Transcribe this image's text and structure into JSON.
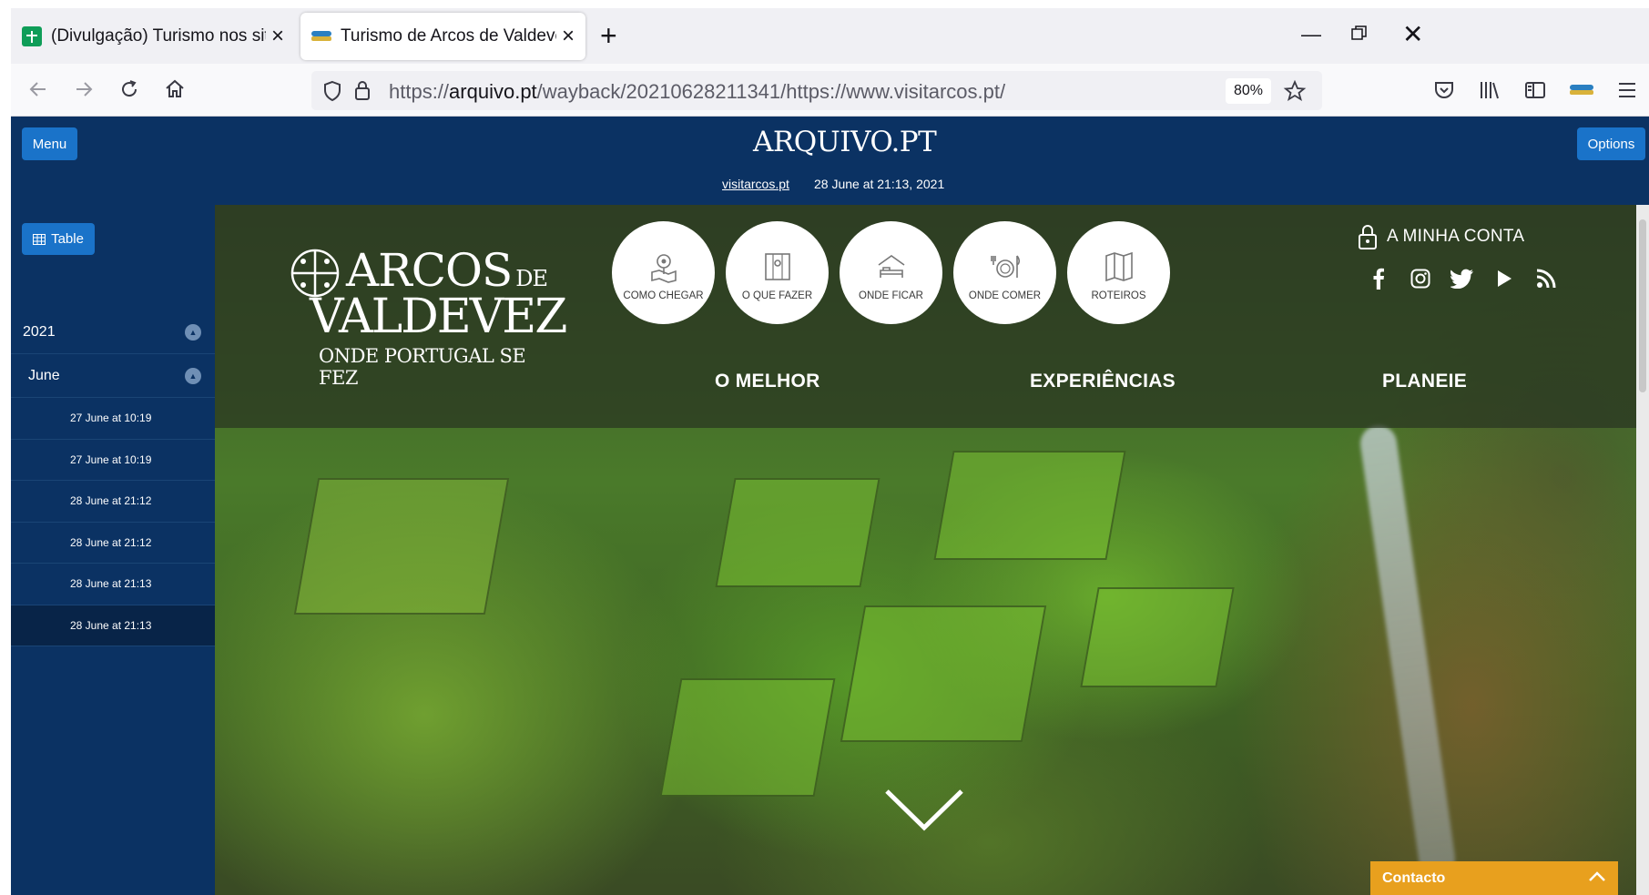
{
  "browser": {
    "tabs": [
      {
        "title": "(Divulgação) Turismo nos sites c",
        "active": false,
        "favicon": "sheets-icon"
      },
      {
        "title": "Turismo de Arcos de Valdevez -",
        "active": true,
        "favicon": "arcos-icon"
      }
    ],
    "url_prefix": "https://",
    "url_domain": "arquivo.pt",
    "url_path": "/wayback/20210628211341/https://www.visitarcos.pt/",
    "zoom": "80%"
  },
  "arquivo": {
    "logo_text": "ARQUIVO.PT",
    "menu_label": "Menu",
    "options_label": "Options",
    "site_link": "visitarcos.pt",
    "capture_date": "28 June at 21:13, 2021",
    "table_label": "Table",
    "year": "2021",
    "month": "June",
    "captures": [
      {
        "label": "27 June at 10:19",
        "active": false
      },
      {
        "label": "27 June at 10:19",
        "active": false
      },
      {
        "label": "28 June at 21:12",
        "active": false
      },
      {
        "label": "28 June at 21:12",
        "active": false
      },
      {
        "label": "28 June at 21:13",
        "active": false
      },
      {
        "label": "28 June at 21:13",
        "active": true
      }
    ]
  },
  "site": {
    "logo_line1": "ARCOS",
    "logo_de": "DE",
    "logo_line2": "VALDEVEZ",
    "logo_tagline": "ONDE PORTUGAL SE FEZ",
    "quick_links": [
      {
        "label": "COMO CHEGAR",
        "icon": "map-pin-icon"
      },
      {
        "label": "O QUE FAZER",
        "icon": "map-icon"
      },
      {
        "label": "ONDE FICAR",
        "icon": "bed-icon"
      },
      {
        "label": "ONDE COMER",
        "icon": "plate-icon"
      },
      {
        "label": "ROTEIROS",
        "icon": "folded-map-icon"
      }
    ],
    "account_label": "A MINHA CONTA",
    "social": [
      "facebook-icon",
      "instagram-icon",
      "twitter-icon",
      "youtube-icon",
      "rss-icon"
    ],
    "nav": [
      "O MELHOR",
      "EXPERIÊNCIAS",
      "PLANEIE"
    ],
    "contact_label": "Contacto",
    "accent_color": "#e8a01e"
  }
}
